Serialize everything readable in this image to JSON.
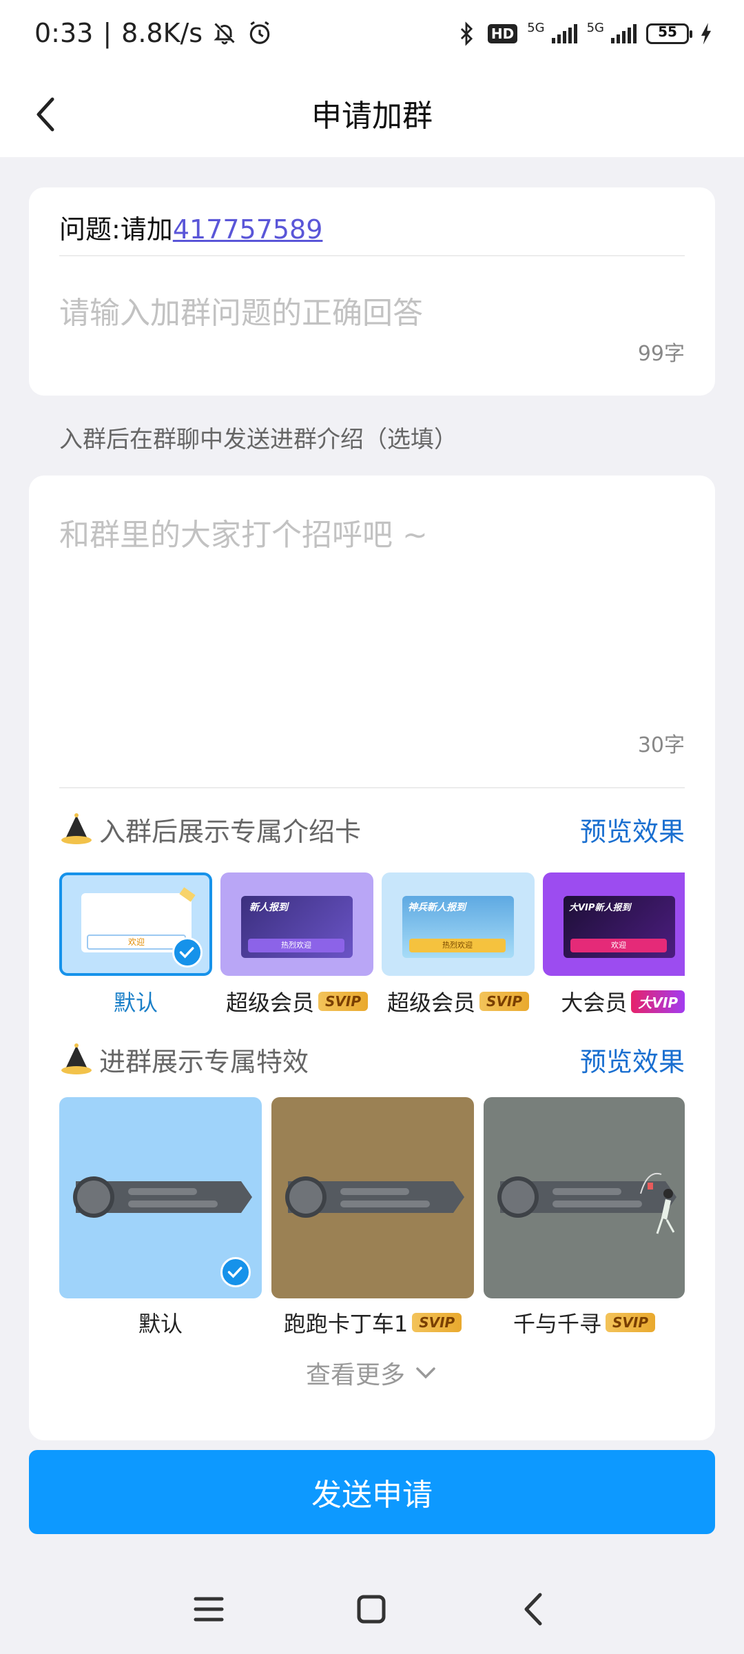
{
  "status_bar": {
    "time": "0:33",
    "network_speed": "8.8K/s",
    "hd_label": "HD",
    "net1": "5G",
    "net2": "5G",
    "battery": "55",
    "battery_level": 0.55
  },
  "header": {
    "title": "申请加群"
  },
  "question": {
    "prefix": "问题:请加",
    "link": "417757589",
    "placeholder": "请输入加群问题的正确回答",
    "char_count": "99字"
  },
  "intro": {
    "label": "入群后在群聊中发送进群介绍（选填）",
    "placeholder": "和群里的大家打个招呼吧 ~",
    "char_count": "30字"
  },
  "intro_card": {
    "title": "入群后展示专属介绍卡",
    "preview": "预览效果",
    "items": [
      {
        "label": "默认",
        "badge": "",
        "selected": true
      },
      {
        "label": "超级会员",
        "badge": "SVIP",
        "selected": false
      },
      {
        "label": "超级会员",
        "badge": "SVIP",
        "selected": false
      },
      {
        "label": "大会员",
        "badge": "大VIP",
        "selected": false
      }
    ],
    "thumb_texts": [
      "欢迎",
      "新人报到",
      "热烈欢迎",
      "神兵新人报到",
      "热烈欢迎",
      "大VIP新人报到",
      "欢迎"
    ]
  },
  "effects": {
    "title": "进群展示专属特效",
    "preview": "预览效果",
    "items": [
      {
        "label": "默认",
        "badge": "",
        "selected": true,
        "bg": "#9fd3fa"
      },
      {
        "label": "跑跑卡丁车1",
        "badge": "SVIP",
        "selected": false,
        "bg": "#9b8154"
      },
      {
        "label": "千与千寻",
        "badge": "SVIP",
        "selected": false,
        "bg": "#787f7b"
      }
    ],
    "more": "查看更多"
  },
  "send_button": "发送申请",
  "colors": {
    "accent": "#0d99ff",
    "link": "#5a56d8",
    "preview": "#1a6fd0"
  }
}
